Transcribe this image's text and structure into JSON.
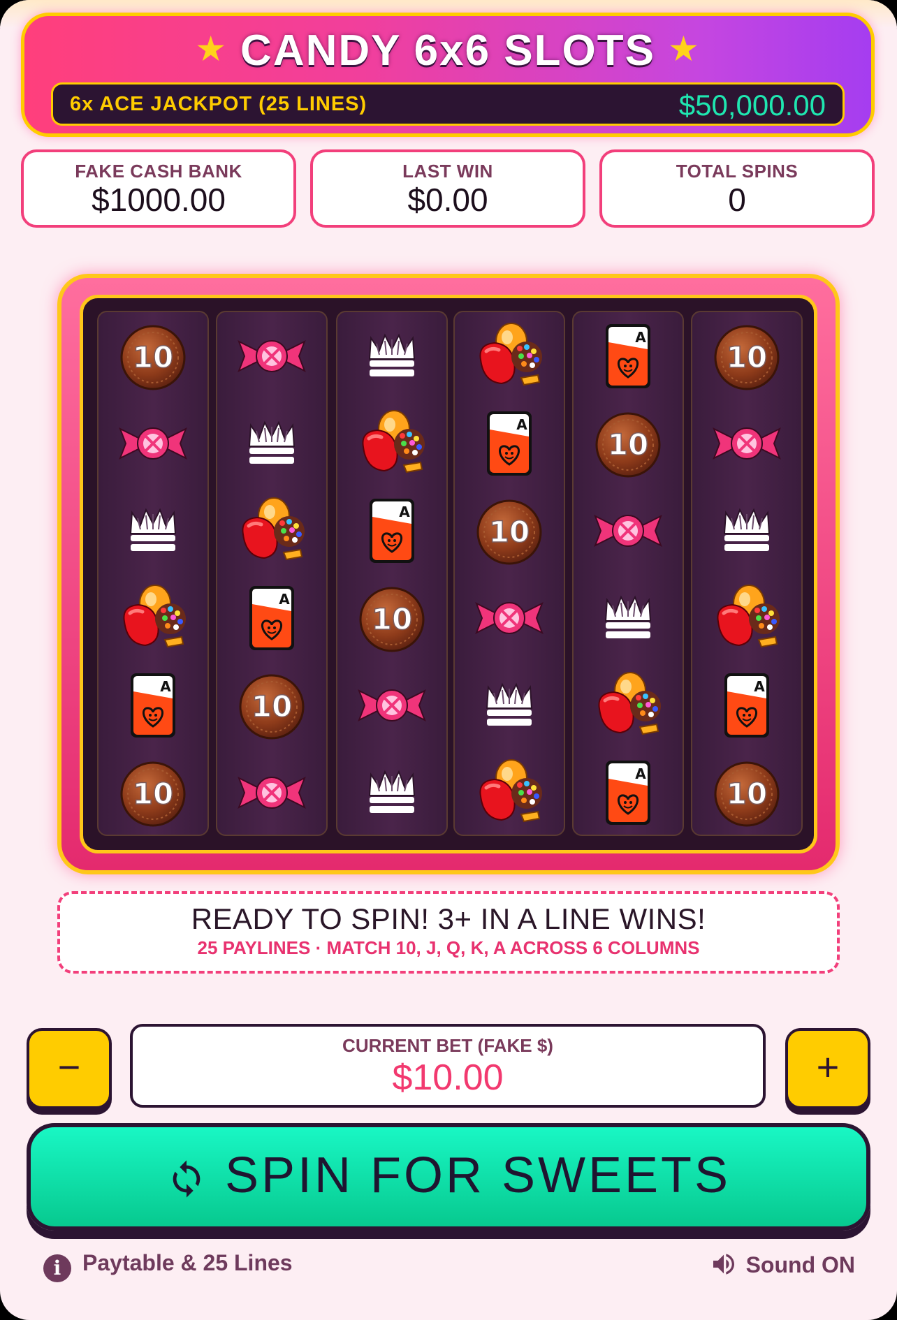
{
  "header": {
    "title": "CANDY 6x6 SLOTS",
    "star": "★",
    "jackpot_label": "6x ACE JACKPOT (25 LINES)",
    "jackpot_value": "$50,000.00"
  },
  "stats": [
    {
      "label": "FAKE CASH BANK",
      "value": "$1000.00"
    },
    {
      "label": "LAST WIN",
      "value": "$0.00"
    },
    {
      "label": "TOTAL SPINS",
      "value": "0"
    }
  ],
  "reels": [
    [
      "ten-chocolate",
      "wrapped-candy",
      "crown",
      "candy-pile",
      "ace-card",
      "ten-chocolate"
    ],
    [
      "wrapped-candy",
      "crown",
      "candy-pile",
      "ace-card",
      "ten-chocolate",
      "wrapped-candy"
    ],
    [
      "crown",
      "candy-pile",
      "ace-card",
      "ten-chocolate",
      "wrapped-candy",
      "crown"
    ],
    [
      "candy-pile",
      "ace-card",
      "ten-chocolate",
      "wrapped-candy",
      "crown",
      "candy-pile"
    ],
    [
      "ace-card",
      "ten-chocolate",
      "wrapped-candy",
      "crown",
      "candy-pile",
      "ace-card"
    ],
    [
      "ten-chocolate",
      "wrapped-candy",
      "crown",
      "candy-pile",
      "ace-card",
      "ten-chocolate"
    ]
  ],
  "status": {
    "main": "READY TO SPIN! 3+ IN A LINE WINS!",
    "sub": "25 PAYLINES · MATCH 10, J, Q, K, A ACROSS 6 COLUMNS"
  },
  "bet": {
    "label": "CURRENT BET (FAKE $)",
    "value": "$10.00",
    "decrease": "−",
    "increase": "+"
  },
  "spin": {
    "label": "SPIN FOR SWEETS",
    "icon": "refresh-icon"
  },
  "footer": {
    "paytable": "Paytable & 25 Lines",
    "sound": "Sound ON",
    "info_icon": "i"
  },
  "colors": {
    "accent_pink": "#f23f7b",
    "gold": "#ffcc00",
    "teal": "#1fe6b0",
    "dark": "#2c1432"
  }
}
